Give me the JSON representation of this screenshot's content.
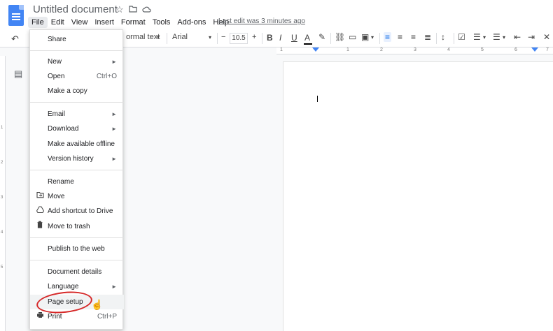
{
  "title_bar": {
    "doc_title": "Untitled document",
    "icons": [
      "star-icon",
      "move-folder-icon",
      "cloud-status-icon"
    ],
    "last_edit": "Last edit was 3 minutes ago"
  },
  "menubar": {
    "items": [
      "File",
      "Edit",
      "View",
      "Insert",
      "Format",
      "Tools",
      "Add-ons",
      "Help"
    ]
  },
  "toolbar": {
    "style_label": "ormal text",
    "font_label": "Arial",
    "font_size": "10.5",
    "minus": "−",
    "plus": "+",
    "bold": "B",
    "italic": "I",
    "underline": "U",
    "text_color": "A"
  },
  "ruler": {
    "numbers": [
      "1",
      "1",
      "2",
      "3",
      "4",
      "5",
      "6",
      "7"
    ]
  },
  "file_menu": {
    "items": {
      "share": "Share",
      "new": "New",
      "open": "Open",
      "open_shortcut": "Ctrl+O",
      "make_copy": "Make a copy",
      "email": "Email",
      "download": "Download",
      "offline": "Make available offline",
      "version_history": "Version history",
      "rename": "Rename",
      "move": "Move",
      "add_shortcut": "Add shortcut to Drive",
      "trash": "Move to trash",
      "publish": "Publish to the web",
      "details": "Document details",
      "language": "Language",
      "page_setup": "Page setup",
      "print": "Print",
      "print_shortcut": "Ctrl+P"
    }
  },
  "colors": {
    "accent": "#1a73e8",
    "docs_blue": "#4285f4",
    "highlight": "#d62828"
  }
}
